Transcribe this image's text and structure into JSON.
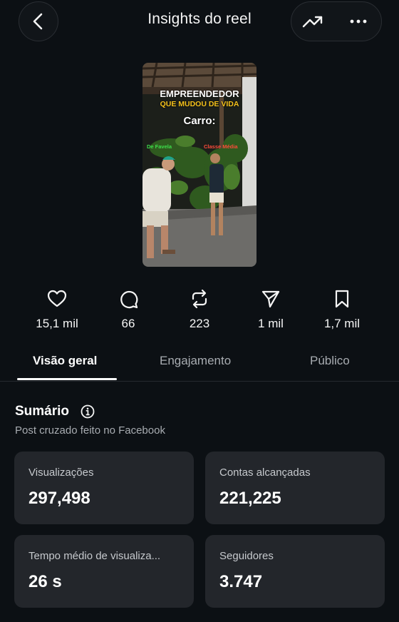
{
  "header": {
    "title": "Insights do reel",
    "back_icon": "chevron-left-icon",
    "trend_icon": "trending-up-icon",
    "more_icon": "more-horizontal-icon"
  },
  "thumbnail": {
    "caption_line1": "EMPREENDEDOR",
    "caption_line2": "QUE MUDOU DE VIDA",
    "caption_line3": "Carro:",
    "tag_left": "De Favela",
    "tag_right": "Classe Média"
  },
  "stats": [
    {
      "icon": "heart-icon",
      "value": "15,1 mil"
    },
    {
      "icon": "comment-icon",
      "value": "66"
    },
    {
      "icon": "repost-icon",
      "value": "223"
    },
    {
      "icon": "share-icon",
      "value": "1 mil"
    },
    {
      "icon": "bookmark-icon",
      "value": "1,7 mil"
    }
  ],
  "tabs": [
    {
      "label": "Visão geral",
      "active": true
    },
    {
      "label": "Engajamento",
      "active": false
    },
    {
      "label": "Público",
      "active": false
    }
  ],
  "summary": {
    "title": "Sumário",
    "subtitle": "Post cruzado feito no Facebook"
  },
  "cards": [
    {
      "label": "Visualizações",
      "value": "297,498"
    },
    {
      "label": "Contas alcançadas",
      "value": "221,225"
    },
    {
      "label": "Tempo médio de visualiza...",
      "value": "26 s"
    },
    {
      "label": "Seguidores",
      "value": "3.747"
    }
  ]
}
